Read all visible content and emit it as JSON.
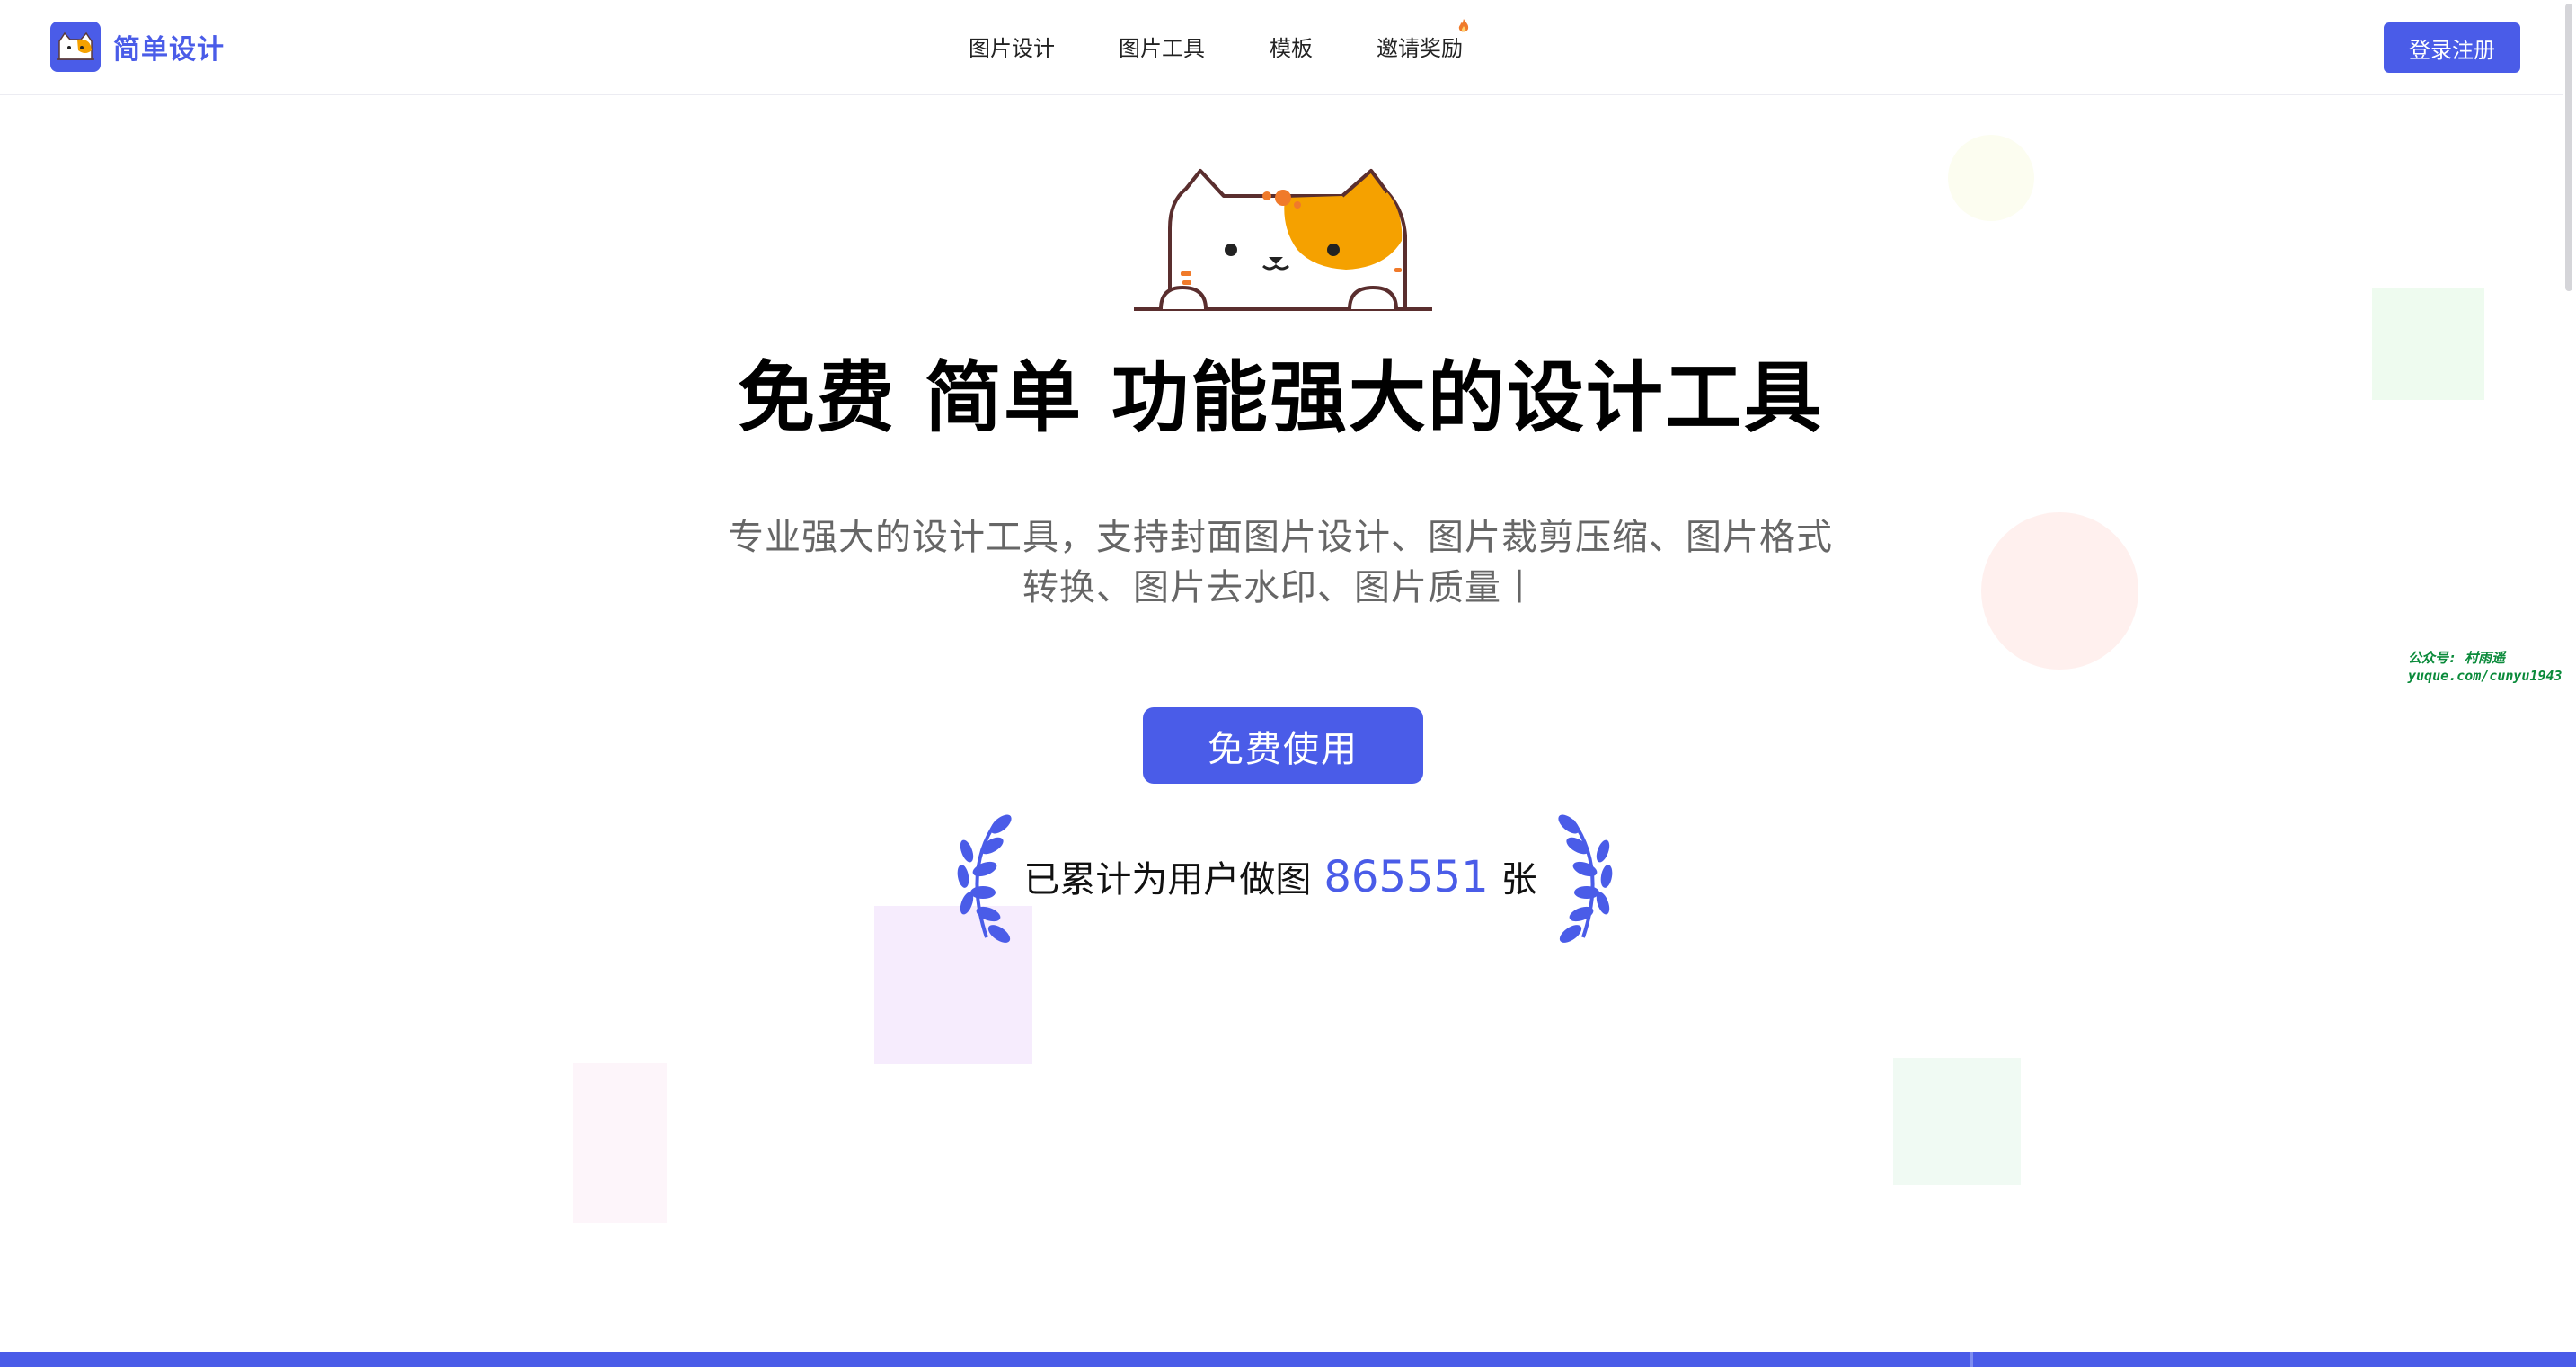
{
  "header": {
    "brand": "简单设计",
    "nav": [
      {
        "label": "图片设计"
      },
      {
        "label": "图片工具"
      },
      {
        "label": "模板"
      },
      {
        "label": "邀请奖励"
      }
    ],
    "login_label": "登录注册"
  },
  "hero": {
    "headline": "免费 简单 功能强大的设计工具",
    "subtitle": "专业强大的设计工具，支持封面图片设计、图片裁剪压缩、图片格式转换、图片去水印、图片质量丨",
    "cta_label": "免费使用",
    "stats_prefix": "已累计为用户做图",
    "stats_count": "865551",
    "stats_suffix": "张"
  },
  "watermark": {
    "line1": "公众号: 村雨遥",
    "line2": "yuque.com/cunyu1943"
  },
  "colors": {
    "accent": "#4a5ce8",
    "cat_orange": "#f5a100",
    "hot_icon": "#f07a2a"
  },
  "icons": [
    "cat-logo-icon",
    "fire-icon",
    "laurel-left-icon",
    "laurel-right-icon",
    "cat-mascot-illustration"
  ]
}
